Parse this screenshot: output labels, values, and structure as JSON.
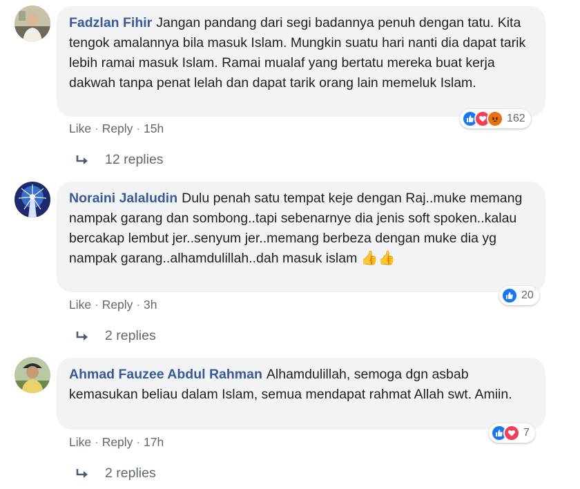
{
  "comments": [
    {
      "author": "Fadzlan Fihir",
      "text": "Jangan pandang dari segi badannya penuh dengan tatu. Kita tengok amalannya bila masuk Islam. Mungkin suatu hari nanti dia dapat tarik lebih ramai masuk Islam. Ramai mualaf yang bertatu mereka buat kerja dakwah tanpa penat lelah dan dapat tarik orang lain memeluk Islam.",
      "reactions": [
        "like",
        "love",
        "angry"
      ],
      "reaction_count": "162",
      "like_label": "Like",
      "reply_label": "Reply",
      "time": "15h",
      "replies_label": "12 replies"
    },
    {
      "author": "Noraini Jalaludin",
      "text": "Dulu penah satu tempat keje dengan Raj..muke memang nampak garang dan sombong..tapi sebenarnye dia jenis soft spoken..kalau bercakap lembut jer..senyum jer..memang berbeza dengan muke dia yg nampak garang..alhamdulillah..dah masuk islam",
      "emoji": "👍👍",
      "reactions": [
        "like"
      ],
      "reaction_count": "20",
      "like_label": "Like",
      "reply_label": "Reply",
      "time": "3h",
      "replies_label": "2 replies"
    },
    {
      "author": "Ahmad Fauzee Abdul Rahman",
      "text": "Alhamdulillah, semoga dgn asbab kemasukan beliau dalam Islam, semua mendapat rahmat Allah swt. Amiin.",
      "reactions": [
        "like",
        "love"
      ],
      "reaction_count": "7",
      "like_label": "Like",
      "reply_label": "Reply",
      "time": "17h",
      "replies_label": "2 replies"
    }
  ],
  "separator": "·",
  "colors": {
    "author": "#385898",
    "bubble": "#f2f3f5",
    "meta": "#606770",
    "like": "#1877f2",
    "love": "#f33e58",
    "angry": "#e9710f"
  }
}
